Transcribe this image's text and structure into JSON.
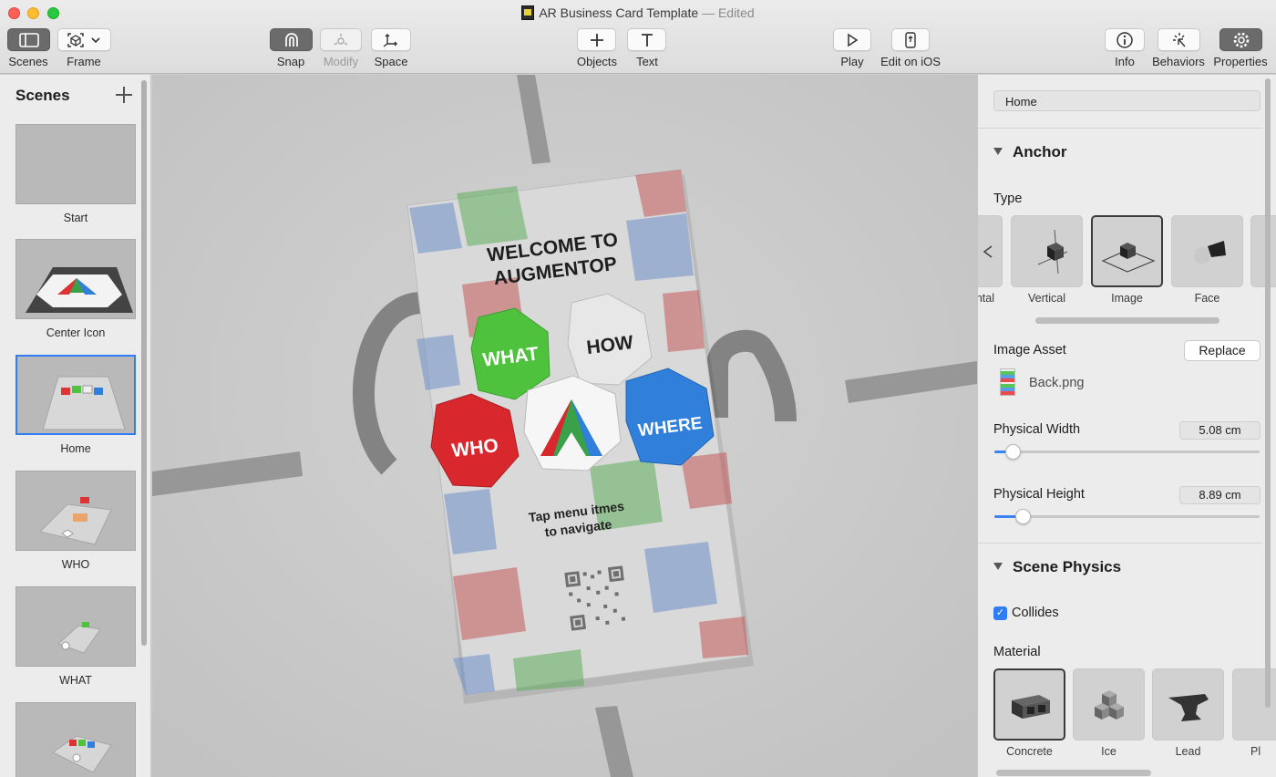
{
  "window": {
    "title": "AR Business Card Template",
    "title_suffix": "— Edited"
  },
  "toolbar": {
    "scenes_label": "Scenes",
    "frame_label": "Frame",
    "snap_label": "Snap",
    "modify_label": "Modify",
    "space_label": "Space",
    "objects_label": "Objects",
    "text_label": "Text",
    "play_label": "Play",
    "edit_ios_label": "Edit on iOS",
    "info_label": "Info",
    "behaviors_label": "Behaviors",
    "properties_label": "Properties"
  },
  "sidebar": {
    "title": "Scenes",
    "scenes": [
      {
        "label": "Start"
      },
      {
        "label": "Center Icon"
      },
      {
        "label": "Home",
        "selected": true
      },
      {
        "label": "WHO"
      },
      {
        "label": "WHAT"
      }
    ]
  },
  "card": {
    "heading_line1": "WELCOME TO",
    "heading_line2": "AUGMENTOP",
    "cube_what": "WHAT",
    "cube_how": "HOW",
    "cube_who": "WHO",
    "cube_where": "WHERE",
    "tap_line1": "Tap menu itmes",
    "tap_line2": "to navigate"
  },
  "inspector": {
    "scene_name": "Home",
    "anchor": {
      "title": "Anchor",
      "type_label": "Type",
      "types": [
        {
          "label": "ntal"
        },
        {
          "label": "Vertical"
        },
        {
          "label": "Image",
          "selected": true
        },
        {
          "label": "Face"
        }
      ],
      "image_asset_label": "Image Asset",
      "replace_label": "Replace",
      "asset_name": "Back.png",
      "width_label": "Physical Width",
      "width_value": "5.08 cm",
      "width_fraction": 0.07,
      "height_label": "Physical Height",
      "height_value": "8.89 cm",
      "height_fraction": 0.105
    },
    "physics": {
      "title": "Scene Physics",
      "collides_label": "Collides",
      "collides_checked": true,
      "material_label": "Material",
      "materials": [
        {
          "label": "Concrete",
          "selected": true
        },
        {
          "label": "Ice"
        },
        {
          "label": "Lead"
        },
        {
          "label": "Pl"
        }
      ]
    }
  },
  "colors": {
    "accent": "#2f7cf6",
    "cube_green": "#4fc23d",
    "cube_red": "#d8282e",
    "cube_blue": "#2f7fdb",
    "cube_white": "#e7e7e7"
  }
}
